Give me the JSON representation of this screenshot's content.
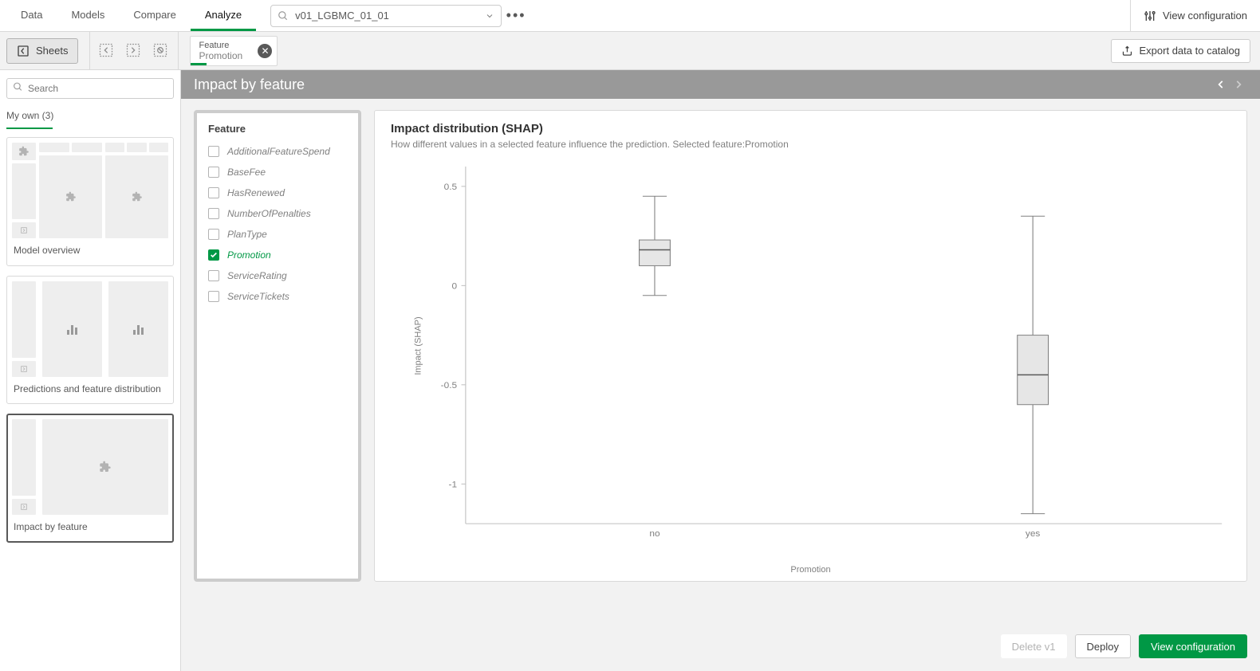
{
  "nav": {
    "tabs": [
      "Data",
      "Models",
      "Compare",
      "Analyze"
    ],
    "active_index": 3,
    "model_name": "v01_LGBMC_01_01",
    "view_configuration": "View configuration"
  },
  "toolbar": {
    "sheets_label": "Sheets",
    "feature_chip": {
      "label": "Feature",
      "value": "Promotion"
    },
    "export_label": "Export data to catalog"
  },
  "sidebar": {
    "search_placeholder": "Search",
    "section_label": "My own (3)",
    "sheets": [
      {
        "title": "Model overview"
      },
      {
        "title": "Predictions and feature distribution"
      },
      {
        "title": "Impact by feature"
      }
    ],
    "selected_index": 2
  },
  "page": {
    "title": "Impact by feature",
    "feature_panel_title": "Feature",
    "features": [
      {
        "name": "AdditionalFeatureSpend",
        "checked": false
      },
      {
        "name": "BaseFee",
        "checked": false
      },
      {
        "name": "HasRenewed",
        "checked": false
      },
      {
        "name": "NumberOfPenalties",
        "checked": false
      },
      {
        "name": "PlanType",
        "checked": false
      },
      {
        "name": "Promotion",
        "checked": true
      },
      {
        "name": "ServiceRating",
        "checked": false
      },
      {
        "name": "ServiceTickets",
        "checked": false
      }
    ],
    "chart_title": "Impact distribution (SHAP)",
    "chart_subtitle": "How different values in a selected feature influence the prediction. Selected feature:Promotion"
  },
  "chart_data": {
    "type": "boxplot",
    "xlabel": "Promotion",
    "ylabel": "Impact (SHAP)",
    "ylim": [
      -1.2,
      0.6
    ],
    "yticks": [
      0.5,
      0,
      -0.5,
      -1
    ],
    "categories": [
      "no",
      "yes"
    ],
    "series": [
      {
        "name": "no",
        "min": -0.05,
        "q1": 0.1,
        "median": 0.18,
        "q3": 0.23,
        "max": 0.45
      },
      {
        "name": "yes",
        "min": -1.15,
        "q1": -0.6,
        "median": -0.45,
        "q3": -0.25,
        "max": 0.35
      }
    ]
  },
  "footer": {
    "delete_label": "Delete v1",
    "deploy_label": "Deploy",
    "view_config_label": "View configuration"
  }
}
